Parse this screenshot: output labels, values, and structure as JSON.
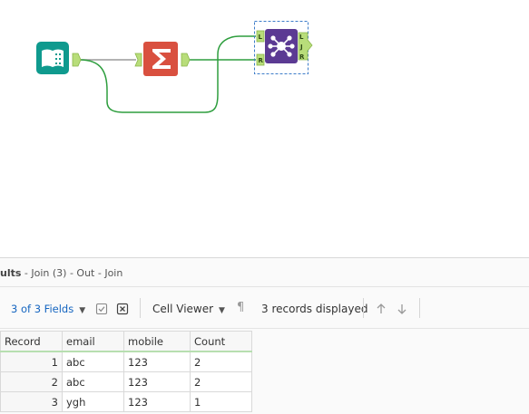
{
  "results": {
    "title_prefix": "ults",
    "title_suffix": " - Join (3) - Out - Join",
    "fields_label": "3 of 3 Fields",
    "cell_viewer_label": "Cell Viewer",
    "records_label": "3 records displayed"
  },
  "tools": {
    "join_left_anchor": "L",
    "join_right_anchor": "R",
    "join_out_left": "L",
    "join_out_join": "J",
    "join_out_right": "R"
  },
  "table": {
    "columns": [
      "Record",
      "email",
      "mobile",
      "Count"
    ],
    "rows": [
      [
        "1",
        "abc",
        "123",
        "2"
      ],
      [
        "2",
        "abc",
        "123",
        "2"
      ],
      [
        "3",
        "ygh",
        "123",
        "1"
      ]
    ]
  },
  "colors": {
    "connector_green": "#2e9e3e",
    "input_tool": "#0f9a8e",
    "summarize_tool": "#d9503f",
    "join_tool": "#5b3a93",
    "link_blue": "#1565c0"
  }
}
